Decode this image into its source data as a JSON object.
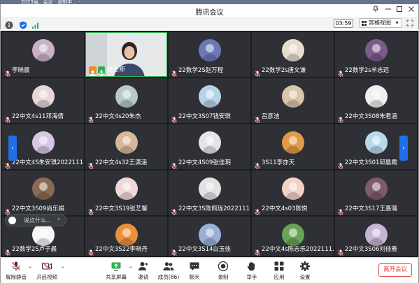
{
  "window": {
    "title": "腾讯会议",
    "blurred_top_text": "2023届..  会议 · 录制中  ..  ·  ·"
  },
  "toolbar": {
    "timer": "03:59",
    "view_label": "宫格视图",
    "view_caret": "▾"
  },
  "participants": [
    {
      "name": "李晓晨",
      "avatar_color": "#c9b2c4"
    },
    {
      "name": "张老师",
      "avatar_color": "#5aa0e0",
      "is_video": true,
      "is_host": true
    },
    {
      "name": "22数学2S赵万程",
      "avatar_color": "#6d78b8"
    },
    {
      "name": "22数学2s唐文谦",
      "avatar_color": "#e7ddcf"
    },
    {
      "name": "22数学2s羊志远",
      "avatar_color": "#7a5b8a"
    },
    {
      "name": "22中文4s11邓海倩",
      "avatar_color": "#e8d7d9"
    },
    {
      "name": "22中文4s20朱杰",
      "avatar_color": "#b9c9c9"
    },
    {
      "name": "22中文3S07钱安琪",
      "avatar_color": "#b8d3e8"
    },
    {
      "name": "吕彦洁",
      "avatar_color": "#d9c6a8"
    },
    {
      "name": "22中文3S08朱君涵",
      "avatar_color": "#f0f0f0"
    },
    {
      "name": "22中文4S朱安琪2022111...",
      "avatar_color": "#d7c7e2"
    },
    {
      "name": "22中文4s32王潇涵",
      "avatar_color": "#d8b89a"
    },
    {
      "name": "22中文4S09张佳玥",
      "avatar_color": "#e4e4e4"
    },
    {
      "name": "3S11李亦天",
      "avatar_color": "#e09a48"
    },
    {
      "name": "22中文3S01邱晨霞",
      "avatar_color": "#b7d9e8"
    },
    {
      "name": "22中文3S09尚乐娟",
      "avatar_color": "#8a6a52"
    },
    {
      "name": "22中文3S19张艺馨",
      "avatar_color": "#efd9d9"
    },
    {
      "name": "22中文3S陈佩珑2022111...",
      "avatar_color": "#e2e2e2"
    },
    {
      "name": "22中文4s03陈悦",
      "avatar_color": "#f3d3c8"
    },
    {
      "name": "22中文3S17王嘉璐",
      "avatar_color": "#7e5a6e"
    },
    {
      "name": "22数学2S卢子晨",
      "avatar_color": "#f5f5f5"
    },
    {
      "name": "22中文3S22李晓丹",
      "avatar_color": "#e8923c"
    },
    {
      "name": "22中文3S14白玉佳",
      "avatar_color": "#9aaed8"
    },
    {
      "name": "22中文4s陈志乐2022111...",
      "avatar_color": "#6aa356"
    },
    {
      "name": "22中文3S06刘佳雅",
      "avatar_color": "#c8b4d6"
    }
  ],
  "chat_bubble": {
    "placeholder": "说点什么...",
    "collapse": "‹"
  },
  "nav": {
    "prev": "‹",
    "next": "›"
  },
  "bottombar": {
    "mute": "解除静音",
    "video": "开启视频",
    "share": "共享屏幕",
    "invite": "邀请",
    "members": "成员(86)",
    "chat": "聊天",
    "record": "录制",
    "raise_hand": "举手",
    "apps": "应用",
    "settings": "设置",
    "leave": "离开会议"
  },
  "colors": {
    "accent": "#1f6fe8",
    "leave": "#e54545",
    "active_border": "#2fb154",
    "tile_bg": "#2e3036"
  }
}
